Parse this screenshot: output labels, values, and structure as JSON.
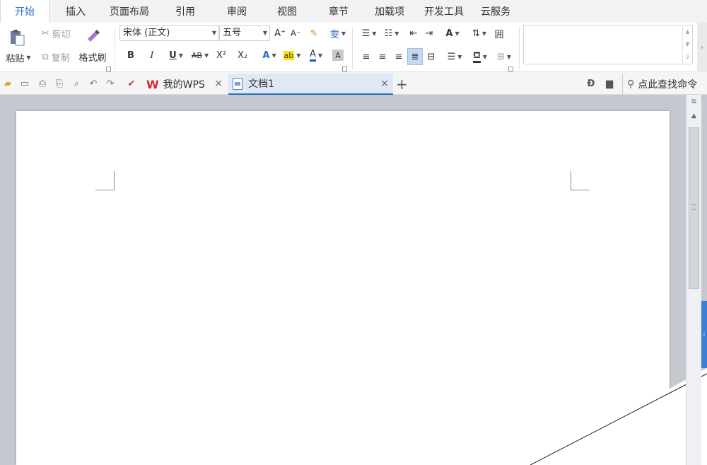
{
  "menu": {
    "tabs": [
      "开始",
      "插入",
      "页面布局",
      "引用",
      "审阅",
      "视图",
      "章节",
      "加载项",
      "开发工具",
      "云服务"
    ],
    "active_tab": "开始"
  },
  "ribbon": {
    "clipboard": {
      "paste_label": "粘贴",
      "cut_label": "剪切",
      "copy_label": "复制",
      "format_painter_label": "格式刷"
    },
    "font": {
      "font_name": "宋体 (正文)",
      "font_size": "五号",
      "grow_label": "A⁺",
      "shrink_label": "A⁻",
      "bold_label": "B",
      "italic_label": "I",
      "underline_label": "U",
      "strike_label": "AB",
      "superscript_label": "X²",
      "subscript_label": "X₂",
      "effects_label": "A",
      "highlight_label": "ab",
      "color_label": "A",
      "shading_label": "A",
      "phonetic_label": "雯"
    },
    "paragraph": {
      "table_label": "囲",
      "text_direction_label": "A"
    },
    "colors": {
      "accent": "#2b6cc4",
      "highlight": "#ffe600",
      "font_color": "#1f4fd6",
      "wps_red": "#d8262d"
    }
  },
  "quickbar": {
    "icons": [
      "open-icon",
      "save-icon",
      "export-pdf-icon",
      "print-icon",
      "print-preview-icon",
      "undo-icon",
      "redo-icon",
      "customize-icon"
    ],
    "tabs": [
      {
        "label": "我的WPS",
        "icon": "wps-logo-icon",
        "active": false
      },
      {
        "label": "文档1",
        "icon": "document-icon",
        "active": true
      }
    ],
    "new_tab_label": "+",
    "search_label": "点此查找命令"
  }
}
